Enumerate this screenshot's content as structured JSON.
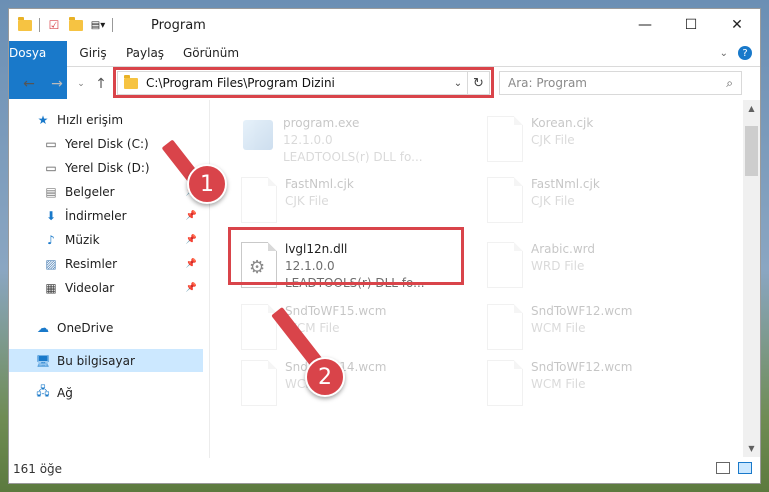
{
  "window": {
    "title": "Program"
  },
  "ribbon": {
    "tabs": [
      "Dosya",
      "Giriş",
      "Paylaş",
      "Görünüm"
    ]
  },
  "address": {
    "path": "C:\\Program Files\\Program Dizini"
  },
  "search": {
    "placeholder": "Ara: Program"
  },
  "sidebar": {
    "items": [
      {
        "label": "Hızlı erişim"
      },
      {
        "label": "Yerel Disk (C:)"
      },
      {
        "label": "Yerel Disk (D:)"
      },
      {
        "label": "Belgeler"
      },
      {
        "label": "İndirmeler"
      },
      {
        "label": "Müzik"
      },
      {
        "label": "Resimler"
      },
      {
        "label": "Videolar"
      },
      {
        "label": "OneDrive"
      },
      {
        "label": "Bu bilgisayar"
      },
      {
        "label": "Ağ"
      }
    ]
  },
  "files": [
    {
      "name": "program.exe",
      "line2": "12.1.0.0",
      "line3": "LEADTOOLS(r) DLL fo..."
    },
    {
      "name": "Korean.cjk",
      "line2": "CJK File",
      "line3": ""
    },
    {
      "name": "FastNml.cjk",
      "line2": "CJK File",
      "line3": ""
    },
    {
      "name": "FastNml.cjk",
      "line2": "CJK File",
      "line3": ""
    },
    {
      "name": "lvgl12n.dll",
      "line2": "12.1.0.0",
      "line3": "LEADTOOLS(r) DLL fo..."
    },
    {
      "name": "Arabic.wrd",
      "line2": "WRD File",
      "line3": ""
    },
    {
      "name": "SndToWF15.wcm",
      "line2": "WCM File",
      "line3": ""
    },
    {
      "name": "SndToWF12.wcm",
      "line2": "WCM File",
      "line3": ""
    },
    {
      "name": "SndToWF14.wcm",
      "line2": "WCM File",
      "line3": ""
    },
    {
      "name": "SndToWF12.wcm",
      "line2": "WCM File",
      "line3": ""
    }
  ],
  "status": {
    "count": "161 öğe"
  },
  "badges": {
    "one": "1",
    "two": "2"
  },
  "colors": {
    "accent": "#1979ca",
    "highlight": "#d9444a",
    "selected": "#cce8ff"
  }
}
